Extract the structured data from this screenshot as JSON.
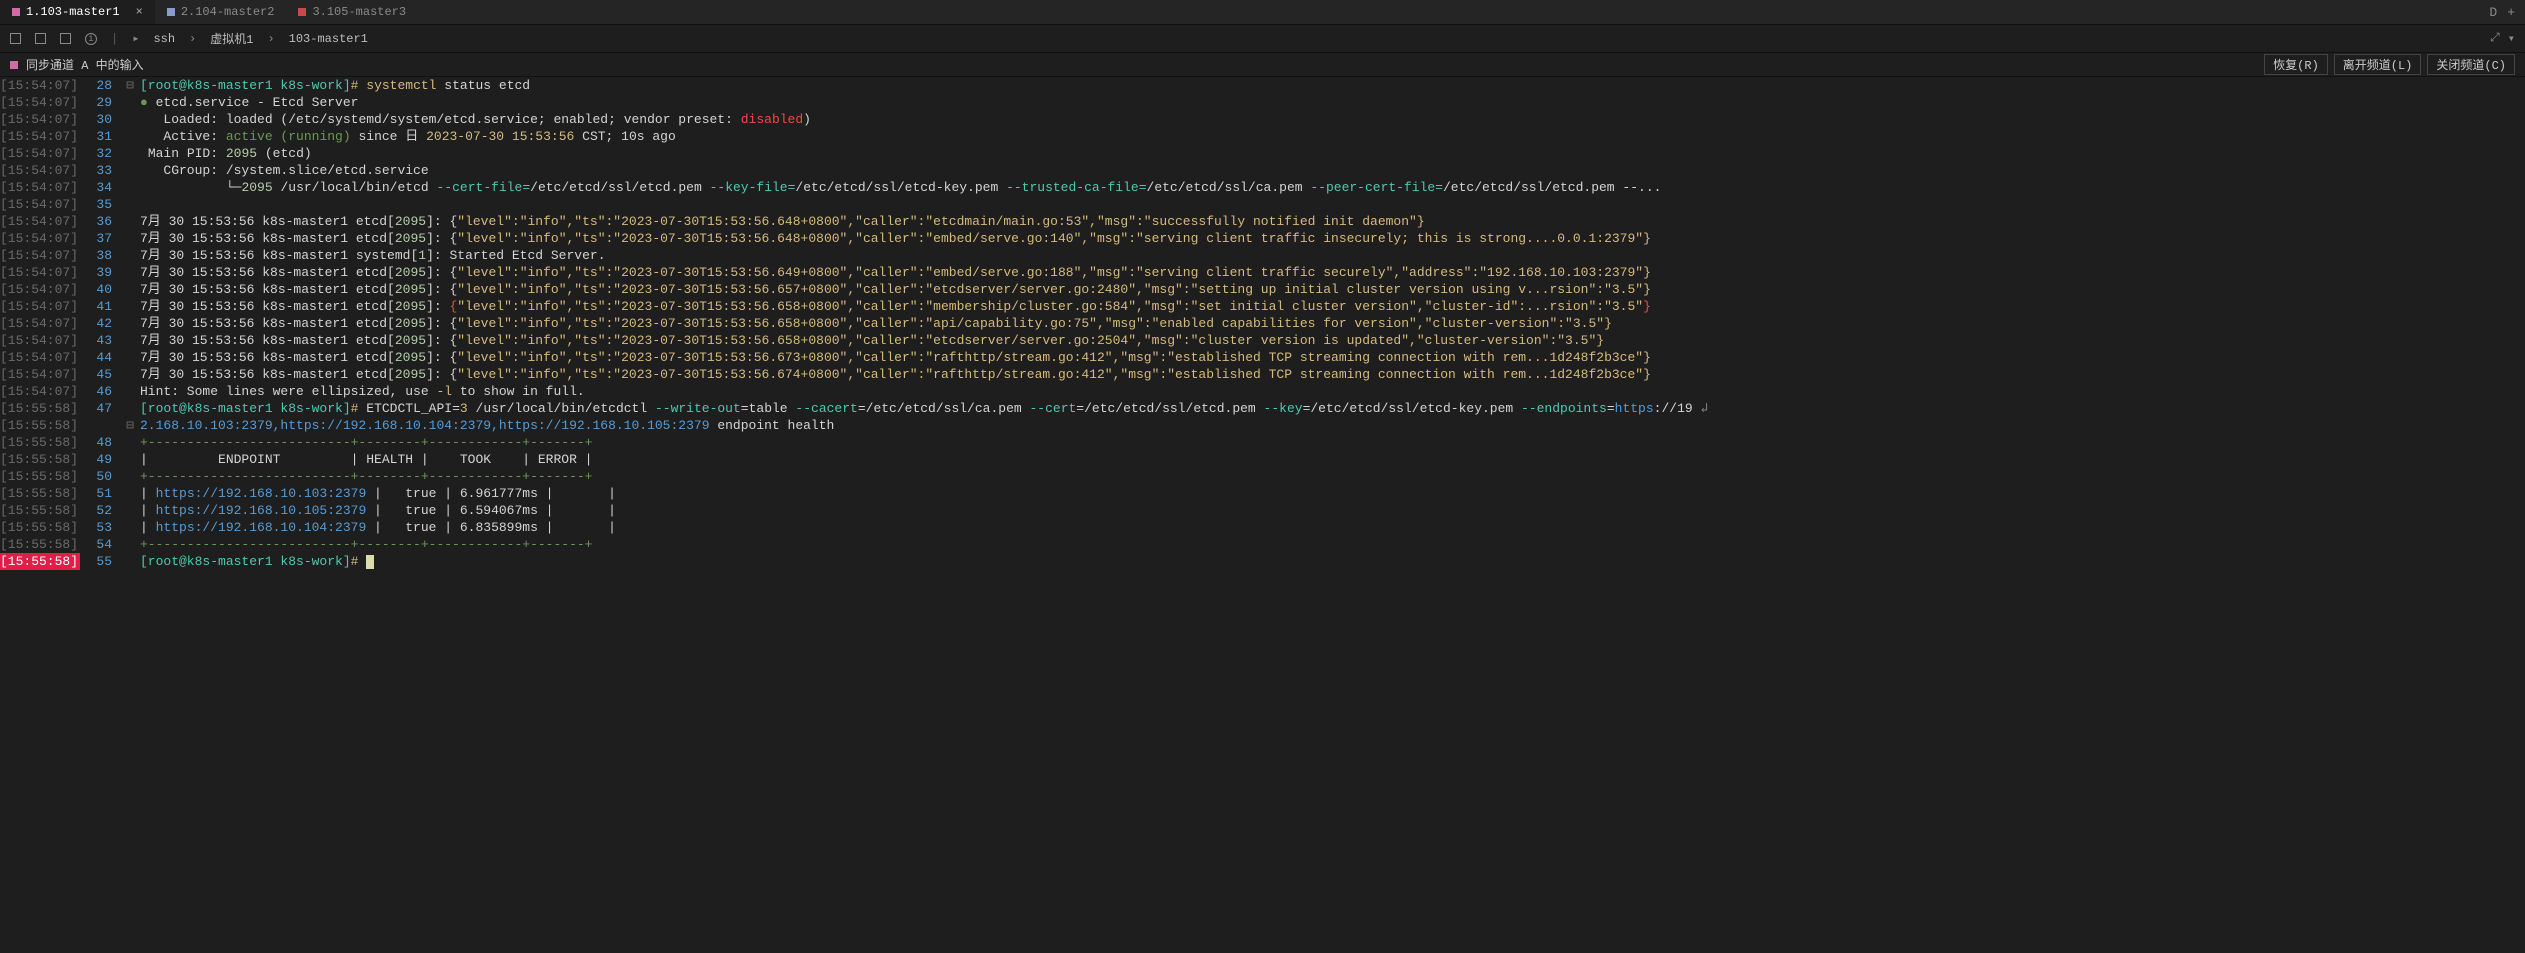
{
  "tabs": [
    {
      "label": "1.103-master1",
      "active": true,
      "dot": "magenta",
      "close": true
    },
    {
      "label": "2.104-master2",
      "active": false,
      "dot": "blueish",
      "close": false
    },
    {
      "label": "3.105-master3",
      "active": false,
      "dot": "red",
      "close": false
    }
  ],
  "tabbar_right": {
    "letter": "D",
    "plus": "+"
  },
  "breadcrumb": {
    "b1": "ssh",
    "b2": "虚拟机1",
    "b3": "103-master1",
    "arrow": "›",
    "play": "▸"
  },
  "statusbar": {
    "label": "同步通道 A 中的输入"
  },
  "status_buttons": {
    "restore": "恢复(R)",
    "leave": "离开频道(L)",
    "close": "关闭频道(C)"
  },
  "timestamps": [
    "15:54:07",
    "15:54:07",
    "15:54:07",
    "15:54:07",
    "15:54:07",
    "15:54:07",
    "15:54:07",
    "15:54:07",
    "15:54:07",
    "15:54:07",
    "15:54:07",
    "15:54:07",
    "15:54:07",
    "15:54:07",
    "15:54:07",
    "15:54:07",
    "15:54:07",
    "15:54:07",
    "15:54:07",
    "15:55:58",
    "15:55:58",
    "15:55:58",
    "15:55:58",
    "15:55:58",
    "15:55:58",
    "15:55:58",
    "15:55:58",
    "15:55:58",
    "15:55:58"
  ],
  "linenos": [
    "28",
    "29",
    "30",
    "31",
    "32",
    "33",
    "34",
    "35",
    "36",
    "37",
    "38",
    "39",
    "40",
    "41",
    "42",
    "43",
    "44",
    "45",
    "46",
    "47",
    "",
    "48",
    "49",
    "50",
    "51",
    "52",
    "53",
    "54",
    "55"
  ],
  "gutters": [
    "⊟",
    "",
    "",
    "",
    "",
    "",
    "",
    "",
    "",
    "",
    "",
    "",
    "",
    "",
    "",
    "",
    "",
    "",
    "",
    "",
    "⊟",
    "",
    "",
    "",
    "",
    "",
    "",
    "",
    ""
  ],
  "prompt": {
    "user": "[root@k8s-master1 k8s-work]",
    "hash": "#"
  },
  "cmd1": {
    "c": "systemctl",
    "a": "status etcd"
  },
  "svc": {
    "dot": "●",
    "name": "etcd.service - Etcd Server",
    "loaded_lbl": "Loaded:",
    "loaded": "loaded (/etc/systemd/system/etcd.service; enabled; vendor preset:",
    "disabled": "disabled",
    "close": ")",
    "active_lbl": "Active:",
    "active": "active",
    "running": "(running)",
    "since": "since 日",
    "date": "2023-07-30 15:53:56",
    "tz": "CST; 10s ago",
    "pid_lbl": "Main PID:",
    "pid": "2095",
    "pid_tail": "(etcd)",
    "cgroup_lbl": "CGroup:",
    "cgroup": "/system.slice/etcd.service",
    "tree": "└─",
    "exec_pid": "2095",
    "exec": "/usr/local/bin/etcd",
    "cert": "--cert-file=",
    "p1": "/etc/etcd/ssl/etcd.pem",
    "key": "--key-file=",
    "p2": "/etc/etcd/ssl/etcd-key.pem",
    "ca": "--trusted-ca-file=",
    "p3": "/etc/etcd/ssl/ca.pem",
    "peer": "--peer-cert-file=",
    "p4": "/etc/etcd/ssl/etcd.pem --..."
  },
  "logs": [
    {
      "pre": "7月 30 15:53:56 k8s-master1 etcd[",
      "pid": "2095",
      "mid": "]: {",
      "body": "\"level\":\"info\",\"ts\":\"2023-07-30T15:53:56.648+0800\",\"caller\":\"etcdmain/main.go:53\",\"msg\":\"successfully notified init daemon\"}"
    },
    {
      "pre": "7月 30 15:53:56 k8s-master1 etcd[",
      "pid": "2095",
      "mid": "]: {",
      "body": "\"level\":\"info\",\"ts\":\"2023-07-30T15:53:56.648+0800\",\"caller\":\"embed/serve.go:140\",\"msg\":\"serving client traffic insecurely; this is strong....0.0.1:2379\"}"
    },
    {
      "pre": "7月 30 15:53:56 k8s-master1 systemd[",
      "pid": "1",
      "mid": "]: Started Etcd Server.",
      "body": ""
    },
    {
      "pre": "7月 30 15:53:56 k8s-master1 etcd[",
      "pid": "2095",
      "mid": "]: {",
      "body": "\"level\":\"info\",\"ts\":\"2023-07-30T15:53:56.649+0800\",\"caller\":\"embed/serve.go:188\",\"msg\":\"serving client traffic securely\",\"address\":\"192.168.10.103:2379\"}"
    },
    {
      "pre": "7月 30 15:53:56 k8s-master1 etcd[",
      "pid": "2095",
      "mid": "]: {",
      "body": "\"level\":\"info\",\"ts\":\"2023-07-30T15:53:56.657+0800\",\"caller\":\"etcdserver/server.go:2480\",\"msg\":\"setting up initial cluster version using v...rsion\":\"3.5\"}"
    },
    {
      "pre": "7月 30 15:53:56 k8s-master1 etcd[",
      "pid": "2095",
      "mid": "]: ",
      "brace": "{",
      "body": "\"level\":\"info\",\"ts\":\"2023-07-30T15:53:56.658+0800\",\"caller\":\"membership/cluster.go:584\",\"msg\":\"set initial cluster version\",\"cluster-id\":...rsion\":\"3.5\"",
      "cbrace": "}"
    },
    {
      "pre": "7月 30 15:53:56 k8s-master1 etcd[",
      "pid": "2095",
      "mid": "]: {",
      "body": "\"level\":\"info\",\"ts\":\"2023-07-30T15:53:56.658+0800\",\"caller\":\"api/capability.go:75\",\"msg\":\"enabled capabilities for version\",\"cluster-version\":\"3.5\"}"
    },
    {
      "pre": "7月 30 15:53:56 k8s-master1 etcd[",
      "pid": "2095",
      "mid": "]: {",
      "body": "\"level\":\"info\",\"ts\":\"2023-07-30T15:53:56.658+0800\",\"caller\":\"etcdserver/server.go:2504\",\"msg\":\"cluster version is updated\",\"cluster-version\":\"3.5\"}"
    },
    {
      "pre": "7月 30 15:53:56 k8s-master1 etcd[",
      "pid": "2095",
      "mid": "]: {",
      "body": "\"level\":\"info\",\"ts\":\"2023-07-30T15:53:56.673+0800\",\"caller\":\"rafthttp/stream.go:412\",\"msg\":\"established TCP streaming connection with rem...1d248f2b3ce\"}"
    },
    {
      "pre": "7月 30 15:53:56 k8s-master1 etcd[",
      "pid": "2095",
      "mid": "]: {",
      "body": "\"level\":\"info\",\"ts\":\"2023-07-30T15:53:56.674+0800\",\"caller\":\"rafthttp/stream.go:412\",\"msg\":\"established TCP streaming connection with rem...1d248f2b3ce\"}"
    }
  ],
  "hint": {
    "pre": "Hint: Some lines were ellipsized, use ",
    "flag": "-l",
    "post": " to show in full."
  },
  "cmd2": {
    "prefix": "ETCDCTL_API=",
    "api": "3",
    "exec": "/usr/local/bin/etcdctl",
    "wo": "--write-out",
    "wov": "=table",
    "ca": "--cacert",
    "cap": "=/etc/etcd/ssl/ca.pem",
    "ce": "--cert",
    "cep": "=/etc/etcd/ssl/etcd.pem",
    "ke": "--key",
    "kep": "=/etc/etcd/ssl/etcd-key.pem",
    "ep": "--endpoints",
    "eq": "=",
    "proto": "https",
    "tail": "://19",
    "cont": "2.168.10.103:2379,https://192.168.10.104:2379,https://192.168.10.105:2379",
    "cmd": "endpoint health"
  },
  "table": {
    "border": "+--------------------------+--------+------------+-------+",
    "header": "|         ENDPOINT         | HEALTH |    TOOK    | ERROR |",
    "rows": [
      {
        "ep": "https://192.168.10.103:2379",
        "h": "true",
        "t": "6.961777ms"
      },
      {
        "ep": "https://192.168.10.105:2379",
        "h": "true",
        "t": "6.594067ms"
      },
      {
        "ep": "https://192.168.10.104:2379",
        "h": "true",
        "t": "6.835899ms"
      }
    ]
  },
  "continuation_arrows": {
    "right": "↳",
    "down": "↲"
  }
}
